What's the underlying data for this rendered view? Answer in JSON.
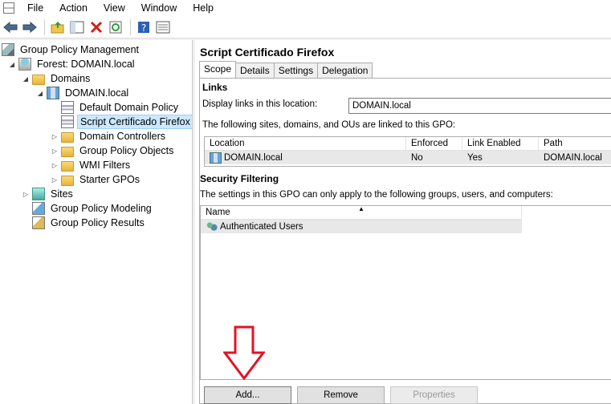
{
  "menu": [
    "File",
    "Action",
    "View",
    "Window",
    "Help"
  ],
  "toolbar_icons": [
    "back-icon",
    "forward-icon",
    "up-folder-icon",
    "show-hide-tree-icon",
    "delete-icon",
    "refresh-icon",
    "help-icon",
    "properties-icon"
  ],
  "tree": {
    "root": "Group Policy Management",
    "forest": "Forest: DOMAIN.local",
    "domains": "Domains",
    "domain": "DOMAIN.local",
    "default_policy": "Default Domain Policy",
    "script_cert": "Script Certificado Firefox",
    "domain_controllers": "Domain Controllers",
    "gpo_objects": "Group Policy Objects",
    "wmi": "WMI Filters",
    "starter": "Starter GPOs",
    "sites": "Sites",
    "modeling": "Group Policy Modeling",
    "results": "Group Policy Results"
  },
  "gpo": {
    "title": "Script Certificado Firefox",
    "tabs": [
      "Scope",
      "Details",
      "Settings",
      "Delegation"
    ],
    "links_title": "Links",
    "display_links_label": "Display links in this location:",
    "display_links_value": "DOMAIN.local",
    "linked_text": "The following sites, domains, and OUs are linked to this GPO:",
    "links_columns": [
      "Location",
      "Enforced",
      "Link Enabled",
      "Path"
    ],
    "links_row": {
      "location": "DOMAIN.local",
      "enforced": "No",
      "link_enabled": "Yes",
      "path": "DOMAIN.local"
    },
    "security_title": "Security Filtering",
    "security_text": "The settings in this GPO can only apply to the following groups, users, and computers:",
    "security_column": "Name",
    "security_row": "Authenticated Users",
    "buttons": {
      "add": "Add...",
      "remove": "Remove",
      "properties": "Properties"
    }
  },
  "colors": {
    "selection": "#cce8ff",
    "arrow": "#e81123"
  }
}
